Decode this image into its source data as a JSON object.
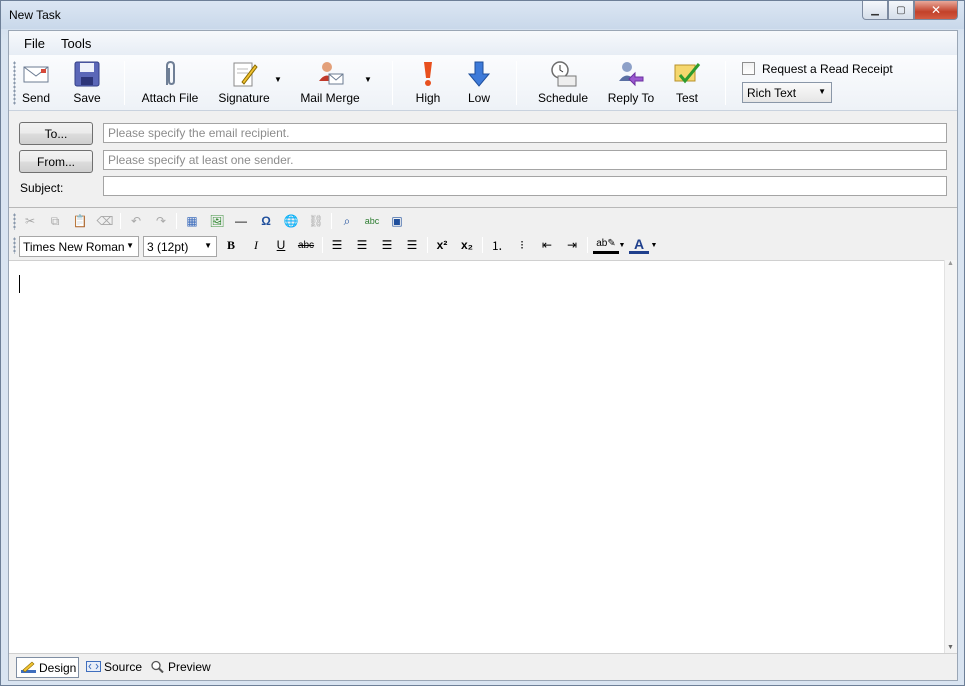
{
  "window": {
    "title": "New Task"
  },
  "menu": {
    "file": "File",
    "tools": "Tools"
  },
  "toolbar": {
    "send": "Send",
    "save": "Save",
    "attach_file": "Attach File",
    "signature": "Signature",
    "mail_merge": "Mail Merge",
    "high": "High",
    "low": "Low",
    "schedule": "Schedule",
    "reply_to": "Reply To",
    "test": "Test",
    "read_receipt": "Request a Read Receipt",
    "format": "Rich Text"
  },
  "address": {
    "to_button": "To...",
    "from_button": "From...",
    "subject_label": "Subject:",
    "to_placeholder": "Please specify the email recipient.",
    "from_placeholder": "Please specify at least one sender.",
    "subject_value": ""
  },
  "format_bar": {
    "font": "Times New Roman",
    "size": "3 (12pt)"
  },
  "view_tabs": {
    "design": "Design",
    "source": "Source",
    "preview": "Preview"
  }
}
